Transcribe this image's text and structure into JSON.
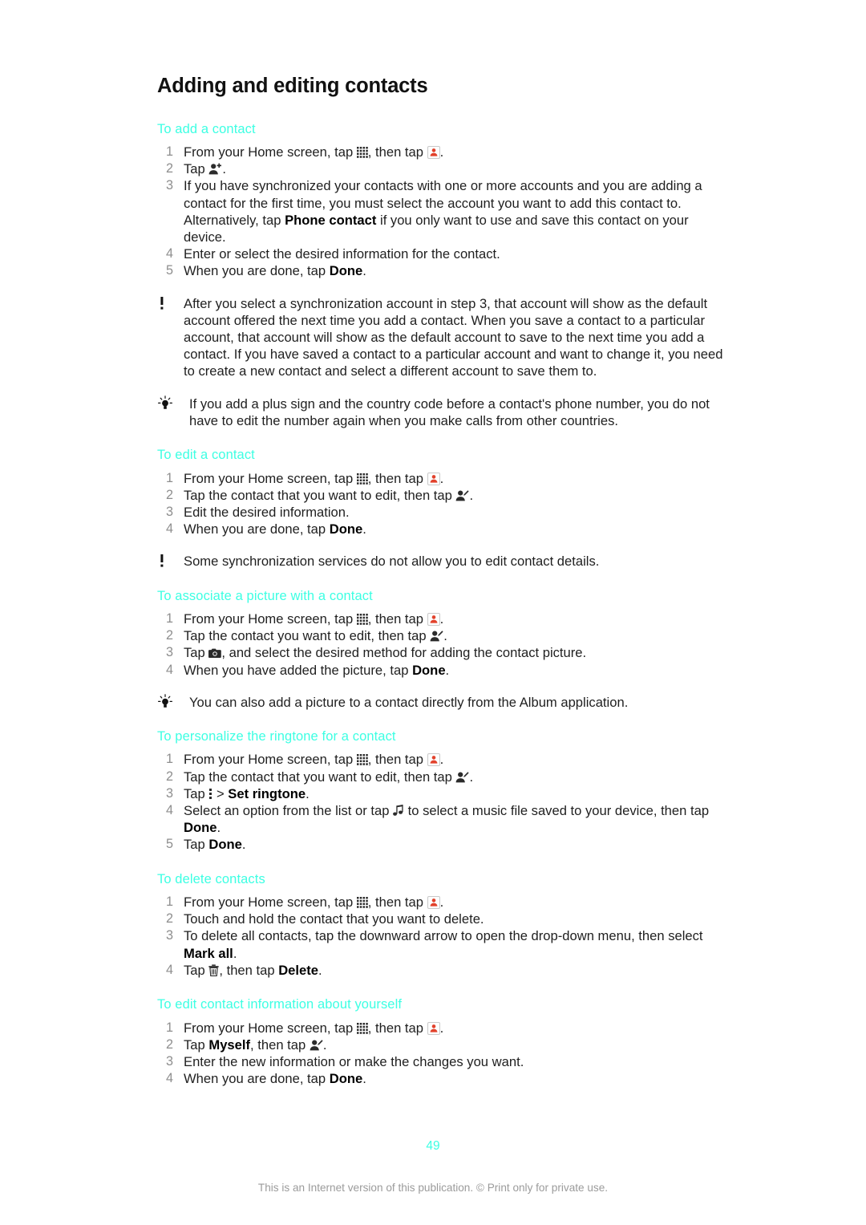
{
  "document": {
    "title": "Adding and editing contacts",
    "page_number": "49",
    "footer": "This is an Internet version of this publication. © Print only for private use."
  },
  "colors": {
    "heading": "#3dffe3",
    "body": "#1f1f1f",
    "step_number": "#8e8e8e",
    "footer": "#9b9b9b",
    "contacts_icon_red": "#e2412b"
  },
  "sections": [
    {
      "heading": "To add a contact",
      "steps": [
        {
          "parts": [
            {
              "t": "text",
              "v": "From your Home screen, tap "
            },
            {
              "t": "icon",
              "v": "apps-grid-icon"
            },
            {
              "t": "text",
              "v": ", then tap "
            },
            {
              "t": "icon",
              "v": "contacts-app-icon"
            },
            {
              "t": "text",
              "v": "."
            }
          ]
        },
        {
          "parts": [
            {
              "t": "text",
              "v": "Tap "
            },
            {
              "t": "icon",
              "v": "add-contact-icon"
            },
            {
              "t": "text",
              "v": "."
            }
          ]
        },
        {
          "parts": [
            {
              "t": "text",
              "v": "If you have synchronized your contacts with one or more accounts and you are adding a contact for the first time, you must select the account you want to add this contact to. Alternatively, tap "
            },
            {
              "t": "bold",
              "v": "Phone contact"
            },
            {
              "t": "text",
              "v": " if you only want to use and save this contact on your device."
            }
          ]
        },
        {
          "parts": [
            {
              "t": "text",
              "v": "Enter or select the desired information for the contact."
            }
          ]
        },
        {
          "parts": [
            {
              "t": "text",
              "v": "When you are done, tap "
            },
            {
              "t": "bold",
              "v": "Done"
            },
            {
              "t": "text",
              "v": "."
            }
          ]
        }
      ],
      "notes": [
        {
          "kind": "warning",
          "icon": "exclamation-icon",
          "parts": [
            {
              "t": "text",
              "v": "After you select a synchronization account in step 3, that account will show as the default account offered the next time you add a contact. When you save a contact to a particular account, that account will show as the default account to save to the next time you add a contact. If you have saved a contact to a particular account and want to change it, you need to create a new contact and select a different account to save them to."
            }
          ]
        },
        {
          "kind": "tip",
          "icon": "lightbulb-icon",
          "parts": [
            {
              "t": "text",
              "v": "If you add a plus sign and the country code before a contact's phone number, you do not have to edit the number again when you make calls from other countries."
            }
          ]
        }
      ]
    },
    {
      "heading": "To edit a contact",
      "steps": [
        {
          "parts": [
            {
              "t": "text",
              "v": "From your Home screen, tap "
            },
            {
              "t": "icon",
              "v": "apps-grid-icon"
            },
            {
              "t": "text",
              "v": ", then tap "
            },
            {
              "t": "icon",
              "v": "contacts-app-icon"
            },
            {
              "t": "text",
              "v": "."
            }
          ]
        },
        {
          "parts": [
            {
              "t": "text",
              "v": "Tap the contact that you want to edit, then tap "
            },
            {
              "t": "icon",
              "v": "edit-contact-icon"
            },
            {
              "t": "text",
              "v": "."
            }
          ]
        },
        {
          "parts": [
            {
              "t": "text",
              "v": "Edit the desired information."
            }
          ]
        },
        {
          "parts": [
            {
              "t": "text",
              "v": "When you are done, tap "
            },
            {
              "t": "bold",
              "v": "Done"
            },
            {
              "t": "text",
              "v": "."
            }
          ]
        }
      ],
      "notes": [
        {
          "kind": "warning",
          "icon": "exclamation-icon",
          "parts": [
            {
              "t": "text",
              "v": "Some synchronization services do not allow you to edit contact details."
            }
          ]
        }
      ]
    },
    {
      "heading": "To associate a picture with a contact",
      "steps": [
        {
          "parts": [
            {
              "t": "text",
              "v": "From your Home screen, tap "
            },
            {
              "t": "icon",
              "v": "apps-grid-icon"
            },
            {
              "t": "text",
              "v": ", then tap "
            },
            {
              "t": "icon",
              "v": "contacts-app-icon"
            },
            {
              "t": "text",
              "v": "."
            }
          ]
        },
        {
          "parts": [
            {
              "t": "text",
              "v": "Tap the contact you want to edit, then tap "
            },
            {
              "t": "icon",
              "v": "edit-contact-icon"
            },
            {
              "t": "text",
              "v": "."
            }
          ]
        },
        {
          "parts": [
            {
              "t": "text",
              "v": "Tap "
            },
            {
              "t": "icon",
              "v": "camera-icon"
            },
            {
              "t": "text",
              "v": ", and select the desired method for adding the contact picture."
            }
          ]
        },
        {
          "parts": [
            {
              "t": "text",
              "v": "When you have added the picture, tap "
            },
            {
              "t": "bold",
              "v": "Done"
            },
            {
              "t": "text",
              "v": "."
            }
          ]
        }
      ],
      "notes": [
        {
          "kind": "tip",
          "icon": "lightbulb-icon",
          "parts": [
            {
              "t": "text",
              "v": "You can also add a picture to a contact directly from the Album application."
            }
          ]
        }
      ]
    },
    {
      "heading": "To personalize the ringtone for a contact",
      "steps": [
        {
          "parts": [
            {
              "t": "text",
              "v": "From your Home screen, tap "
            },
            {
              "t": "icon",
              "v": "apps-grid-icon"
            },
            {
              "t": "text",
              "v": ", then tap "
            },
            {
              "t": "icon",
              "v": "contacts-app-icon"
            },
            {
              "t": "text",
              "v": "."
            }
          ]
        },
        {
          "parts": [
            {
              "t": "text",
              "v": "Tap the contact that you want to edit, then tap "
            },
            {
              "t": "icon",
              "v": "edit-contact-icon"
            },
            {
              "t": "text",
              "v": "."
            }
          ]
        },
        {
          "parts": [
            {
              "t": "text",
              "v": "Tap "
            },
            {
              "t": "icon",
              "v": "overflow-menu-icon"
            },
            {
              "t": "text",
              "v": " > "
            },
            {
              "t": "bold",
              "v": "Set ringtone"
            },
            {
              "t": "text",
              "v": "."
            }
          ]
        },
        {
          "parts": [
            {
              "t": "text",
              "v": "Select an option from the list or tap "
            },
            {
              "t": "icon",
              "v": "music-note-icon"
            },
            {
              "t": "text",
              "v": " to select a music file saved to your device, then tap "
            },
            {
              "t": "bold",
              "v": "Done"
            },
            {
              "t": "text",
              "v": "."
            }
          ]
        },
        {
          "parts": [
            {
              "t": "text",
              "v": "Tap "
            },
            {
              "t": "bold",
              "v": "Done"
            },
            {
              "t": "text",
              "v": "."
            }
          ]
        }
      ],
      "notes": []
    },
    {
      "heading": "To delete contacts",
      "steps": [
        {
          "parts": [
            {
              "t": "text",
              "v": "From your Home screen, tap "
            },
            {
              "t": "icon",
              "v": "apps-grid-icon"
            },
            {
              "t": "text",
              "v": ", then tap "
            },
            {
              "t": "icon",
              "v": "contacts-app-icon"
            },
            {
              "t": "text",
              "v": "."
            }
          ]
        },
        {
          "parts": [
            {
              "t": "text",
              "v": "Touch and hold the contact that you want to delete."
            }
          ]
        },
        {
          "parts": [
            {
              "t": "text",
              "v": "To delete all contacts, tap the downward arrow to open the drop-down menu, then select "
            },
            {
              "t": "bold",
              "v": "Mark all"
            },
            {
              "t": "text",
              "v": "."
            }
          ]
        },
        {
          "parts": [
            {
              "t": "text",
              "v": "Tap "
            },
            {
              "t": "icon",
              "v": "trash-icon"
            },
            {
              "t": "text",
              "v": ", then tap "
            },
            {
              "t": "bold",
              "v": "Delete"
            },
            {
              "t": "text",
              "v": "."
            }
          ]
        }
      ],
      "notes": []
    },
    {
      "heading": "To edit contact information about yourself",
      "steps": [
        {
          "parts": [
            {
              "t": "text",
              "v": "From your Home screen, tap "
            },
            {
              "t": "icon",
              "v": "apps-grid-icon"
            },
            {
              "t": "text",
              "v": ", then tap "
            },
            {
              "t": "icon",
              "v": "contacts-app-icon"
            },
            {
              "t": "text",
              "v": "."
            }
          ]
        },
        {
          "parts": [
            {
              "t": "text",
              "v": "Tap "
            },
            {
              "t": "bold",
              "v": "Myself"
            },
            {
              "t": "text",
              "v": ", then tap "
            },
            {
              "t": "icon",
              "v": "edit-contact-icon"
            },
            {
              "t": "text",
              "v": "."
            }
          ]
        },
        {
          "parts": [
            {
              "t": "text",
              "v": "Enter the new information or make the changes you want."
            }
          ]
        },
        {
          "parts": [
            {
              "t": "text",
              "v": "When you are done, tap "
            },
            {
              "t": "bold",
              "v": "Done"
            },
            {
              "t": "text",
              "v": "."
            }
          ]
        }
      ],
      "notes": []
    }
  ]
}
